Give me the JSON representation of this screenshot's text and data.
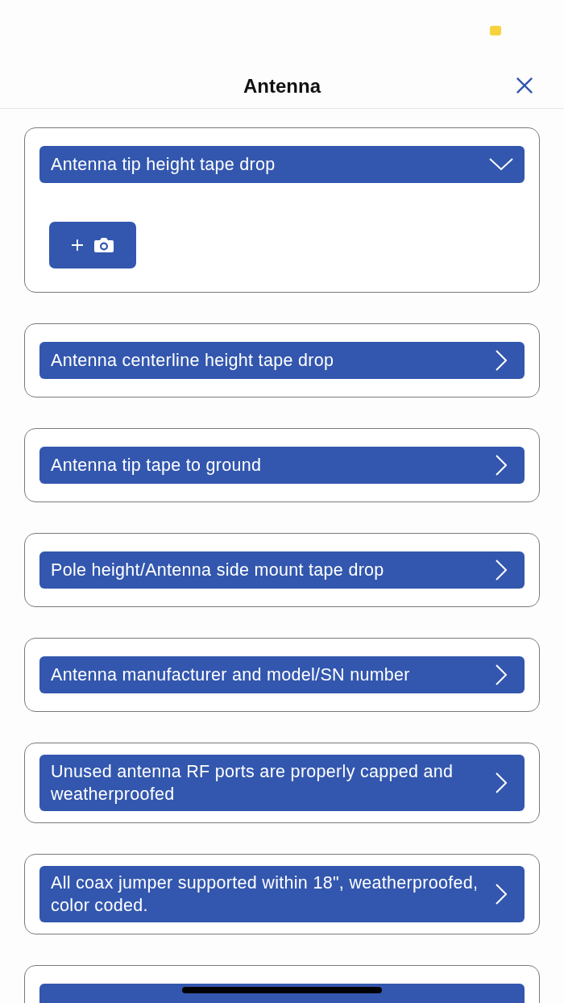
{
  "header": {
    "title": "Antenna"
  },
  "sections": [
    {
      "title": "Antenna tip height tape drop",
      "expanded": true
    },
    {
      "title": "Antenna centerline height tape drop",
      "expanded": false
    },
    {
      "title": "Antenna tip tape to ground",
      "expanded": false
    },
    {
      "title": "Pole height/Antenna side mount tape drop",
      "expanded": false
    },
    {
      "title": "Antenna manufacturer and model/SN number",
      "expanded": false
    },
    {
      "title": "Unused antenna RF ports are properly capped and weatherproofed",
      "expanded": false
    },
    {
      "title": "All coax jumper supported within 18\", weatherproofed, color coded.",
      "expanded": false
    },
    {
      "expanded": false
    }
  ]
}
